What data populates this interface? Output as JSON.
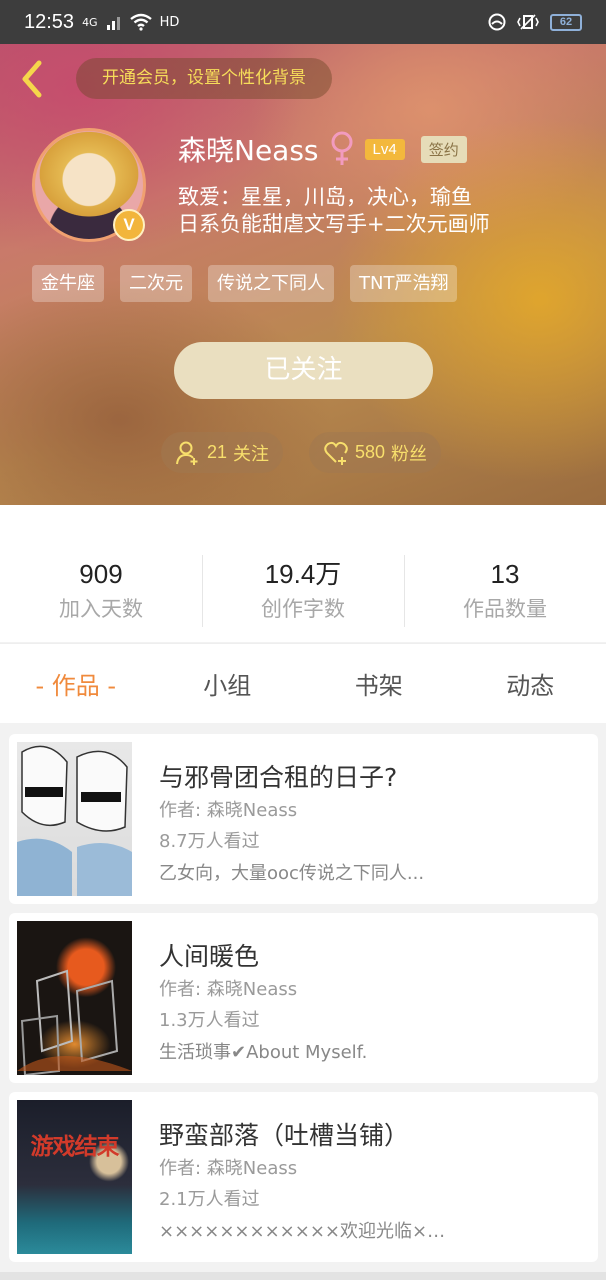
{
  "status_bar": {
    "time": "12:53",
    "network": "4G",
    "hd": "HD",
    "battery": "62"
  },
  "header": {
    "vip_prompt": "开通会员，设置个性化背景"
  },
  "profile": {
    "name": "森晓Neass",
    "level": "Lv4",
    "sign_badge": "签约",
    "verified_mark": "V",
    "bio_line1": "致爱：星星，川岛，决心，瑜鱼",
    "bio_line2": "日系负能甜虐文写手+二次元画师",
    "tags": [
      "金牛座",
      "二次元",
      "传说之下同人",
      "TNT严浩翔"
    ],
    "follow_button": "已关注",
    "following": {
      "count": "21",
      "label": "关注"
    },
    "fans": {
      "count": "580",
      "label": "粉丝"
    }
  },
  "stats": [
    {
      "value": "909",
      "label": "加入天数"
    },
    {
      "value": "19.4万",
      "label": "创作字数"
    },
    {
      "value": "13",
      "label": "作品数量"
    }
  ],
  "tabs": [
    "- 作品 -",
    "小组",
    "书架",
    "动态"
  ],
  "books": [
    {
      "title": "与邪骨团合租的日子?",
      "author": "作者: 森晓Neass",
      "views": "8.7万人看过",
      "desc": "乙女向，大量ooc传说之下同人..."
    },
    {
      "title": "人间暖色",
      "author": "作者: 森晓Neass",
      "views": "1.3万人看过",
      "desc": "生活琐事✔About Myself."
    },
    {
      "title": "野蛮部落（吐槽当铺）",
      "author": "作者: 森晓Neass",
      "views": "2.1万人看过",
      "desc": "××××××××××××欢迎光临××××···",
      "cover_text": "游戏结束"
    }
  ],
  "colors": {
    "accent": "#f08a3c",
    "vip_text": "#f7dd5a",
    "level_badge": "#f3b83c"
  }
}
